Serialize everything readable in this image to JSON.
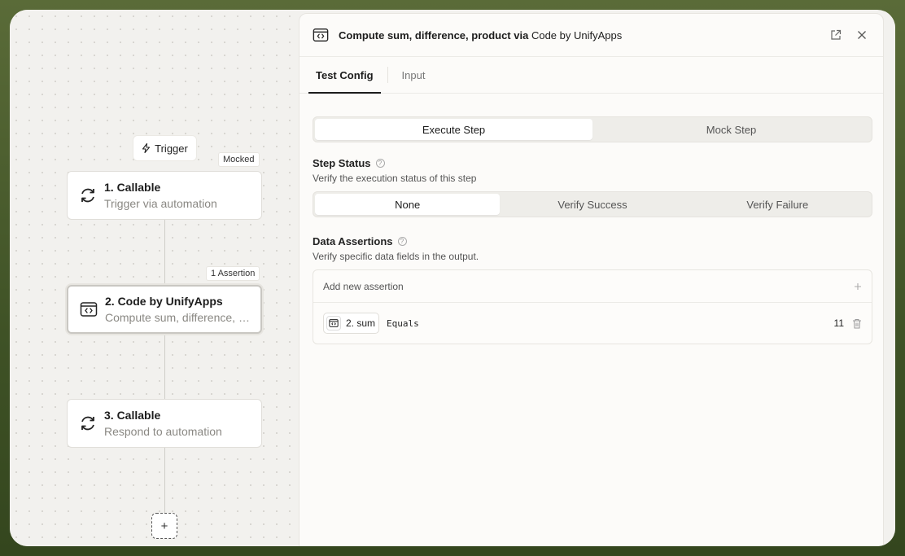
{
  "canvas": {
    "trigger_label": "Trigger",
    "mocked_badge": "Mocked",
    "assertion_badge": "1 Assertion",
    "nodes": [
      {
        "title": "1. Callable",
        "subtitle": "Trigger via automation"
      },
      {
        "title": "2. Code by UnifyApps",
        "subtitle": "Compute sum, difference, product via Code by UnifyApps"
      },
      {
        "title": "3. Callable",
        "subtitle": "Respond to automation"
      }
    ],
    "add_label": "+"
  },
  "panel": {
    "title": "Compute sum, difference, product via",
    "title_highlight": "Code by UnifyApps",
    "tabs": [
      "Test Config",
      "Input"
    ],
    "mode_options": [
      "Execute Step",
      "Mock Step"
    ],
    "step_status": {
      "title": "Step Status",
      "description": "Verify the execution status of this step",
      "options": [
        "None",
        "Verify Success",
        "Verify Failure"
      ]
    },
    "data_assertions": {
      "title": "Data Assertions",
      "description": "Verify specific data fields in the output.",
      "add_label": "Add new assertion",
      "rows": [
        {
          "field": "2. sum",
          "operator": "Equals",
          "value": "11"
        }
      ]
    }
  }
}
